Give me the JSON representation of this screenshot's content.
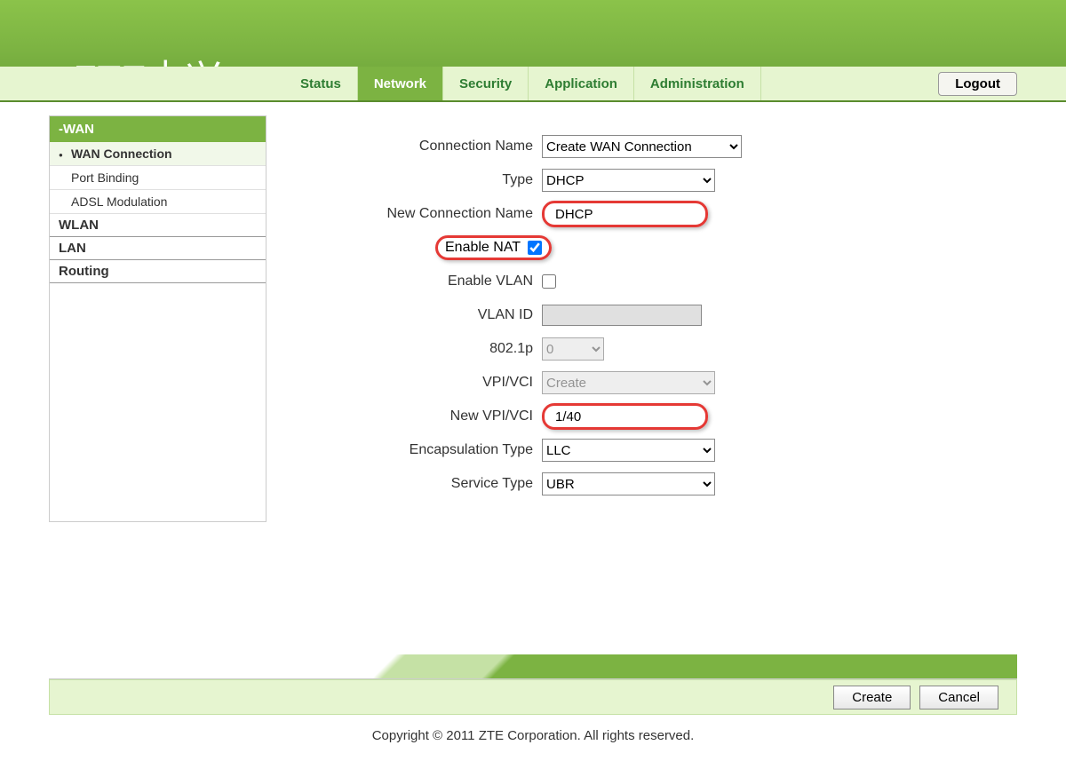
{
  "brand": {
    "logo": "ZTE",
    "logo_cn": "中兴"
  },
  "nav": {
    "tabs": [
      {
        "label": "Status"
      },
      {
        "label": "Network"
      },
      {
        "label": "Security"
      },
      {
        "label": "Application"
      },
      {
        "label": "Administration"
      }
    ],
    "active": 1,
    "logout": "Logout"
  },
  "sidebar": {
    "section": "-WAN",
    "items": [
      {
        "label": "WAN Connection"
      },
      {
        "label": "Port Binding"
      },
      {
        "label": "ADSL Modulation"
      }
    ],
    "groups": [
      {
        "label": "WLAN"
      },
      {
        "label": "LAN"
      },
      {
        "label": "Routing"
      }
    ]
  },
  "form": {
    "connection_name_label": "Connection Name",
    "connection_name_value": "Create WAN Connection",
    "type_label": "Type",
    "type_value": "DHCP",
    "new_connection_name_label": "New Connection Name",
    "new_connection_name_value": "DHCP",
    "enable_nat_label": "Enable NAT",
    "enable_nat_checked": true,
    "enable_vlan_label": "Enable VLAN",
    "enable_vlan_checked": false,
    "vlan_id_label": "VLAN ID",
    "vlan_id_value": "",
    "p8021_label": "802.1p",
    "p8021_value": "0",
    "vpi_vci_label": "VPI/VCI",
    "vpi_vci_value": "Create",
    "new_vpi_vci_label": "New VPI/VCI",
    "new_vpi_vci_value": "1/40",
    "encap_label": "Encapsulation Type",
    "encap_value": "LLC",
    "service_label": "Service Type",
    "service_value": "UBR"
  },
  "actions": {
    "create": "Create",
    "cancel": "Cancel"
  },
  "copyright": "Copyright © 2011 ZTE Corporation. All rights reserved."
}
